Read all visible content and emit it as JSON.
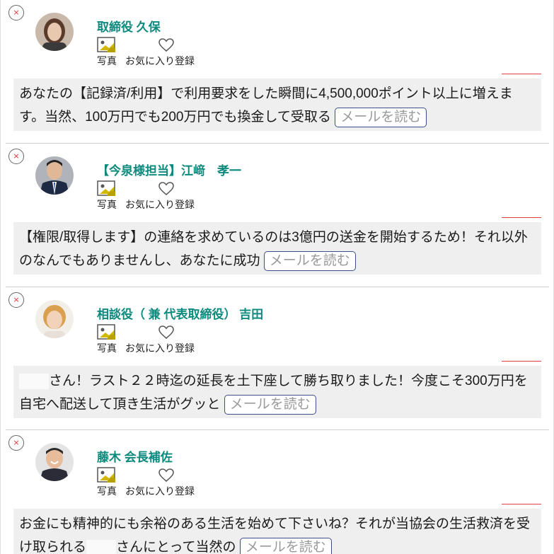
{
  "messages": [
    {
      "sender": "取締役 久保",
      "photo_label": "写真",
      "favorite_label": "お気に入り登録",
      "body_before": "",
      "body": "あなたの【記録済/利用】で利用要求をした瞬間に4,500,000ポイント以上に増えます。当然、100万円でも200万円でも換金して受取る",
      "body_after": "",
      "read_label": "メールを読む"
    },
    {
      "sender": "【今泉様担当】江﨑　孝一",
      "photo_label": "写真",
      "favorite_label": "お気に入り登録",
      "body_before": "",
      "body": "【権限/取得します】の連絡を求めているのは3億円の送金を開始するため！それ以外のなんでもありませんし、あなたに成功",
      "body_after": "",
      "read_label": "メールを読む"
    },
    {
      "sender": "相談役（ 兼 代表取締役） 吉田",
      "photo_label": "写真",
      "favorite_label": "お気に入り登録",
      "body_before": "",
      "body": "さん！ラスト２２時迄の延長を土下座して勝ち取りました！今度こそ300万円を自宅へ配送して頂き生活がグッと",
      "body_after": "",
      "read_label": "メールを読む"
    },
    {
      "sender": "藤木 会長補佐",
      "photo_label": "写真",
      "favorite_label": "お気に入り登録",
      "body_before": "お金にも精神的にも余裕のある生活を始めて下さいね？それが当協会の生活救済を受け取られる",
      "body": "さんにとって当然の",
      "body_after": "",
      "read_label": "メールを読む"
    }
  ],
  "colors": {
    "sender_name": "#0d8a7e",
    "close_x": "#e03030",
    "message_bg": "#efefef",
    "read_button_border": "#3b4f8c",
    "read_button_text": "#9a9a9a",
    "accent_line": "#e04040"
  },
  "icons": {
    "close": "close-icon",
    "photo": "photo-icon",
    "favorite": "heart-icon"
  }
}
